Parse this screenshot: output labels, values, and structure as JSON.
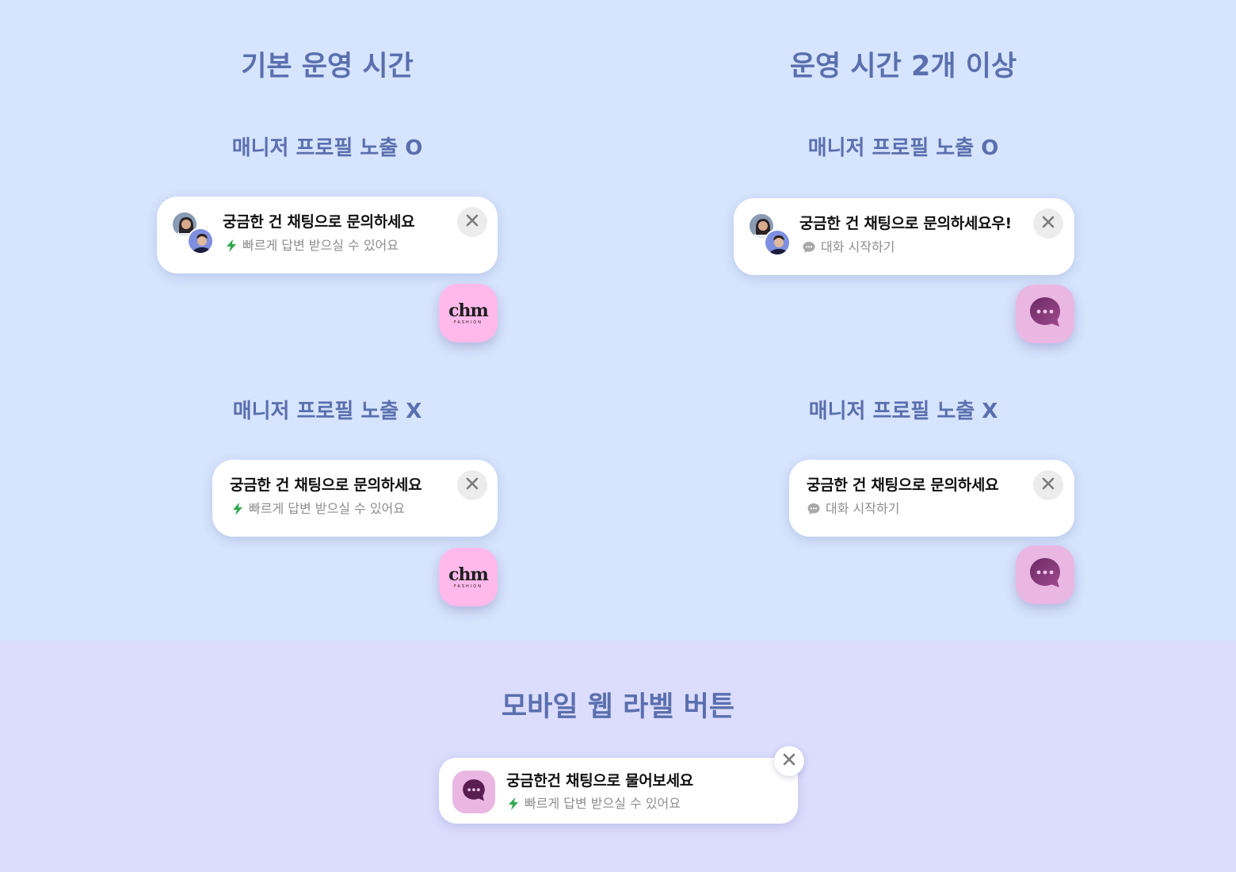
{
  "sections": {
    "default_hours": {
      "title": "기본 운영 시간",
      "profile_on": {
        "label": "매니저 프로필 노출 O",
        "card": {
          "title": "궁금한 건 채팅으로 문의하세요",
          "subtitle": "빠르게 답변 받으실 수 있어요"
        }
      },
      "profile_off": {
        "label": "매니저 프로필 노출 X",
        "card": {
          "title": "궁금한 건 채팅으로 문의하세요",
          "subtitle": "빠르게 답변 받으실 수 있어요"
        }
      },
      "launcher": {
        "brand_name": "chm",
        "brand_sub": "FASHION"
      }
    },
    "multi_hours": {
      "title": "운영 시간 2개 이상",
      "profile_on": {
        "label": "매니저 프로필 노출 O",
        "card": {
          "title": "궁금한 건 채팅으로 문의하세요우!",
          "subtitle": "대화 시작하기"
        }
      },
      "profile_off": {
        "label": "매니저 프로필 노출 X",
        "card": {
          "title": "궁금한 건 채팅으로 문의하세요",
          "subtitle": "대화 시작하기"
        }
      }
    },
    "mobile_label": {
      "title": "모바일 웹 라벨 버튼",
      "card": {
        "title": "궁금한건 채팅으로 물어보세요",
        "subtitle": "빠르게 답변 받으실 수 있어요"
      }
    }
  },
  "icons": {
    "close": "close-icon",
    "lightning": "lightning-icon",
    "chat_bubble": "chat-bubble-icon",
    "chat_launcher": "chat-launcher-icon"
  },
  "colors": {
    "top_background": "#d6e4fd",
    "bottom_background": "#dcdcfd",
    "heading": "#5a6fae",
    "lightning": "#2fa84f",
    "brand_launcher": "#ffb9ea",
    "chat_launcher": "#eab7e3",
    "chat_icon": "#5a1d4f"
  }
}
